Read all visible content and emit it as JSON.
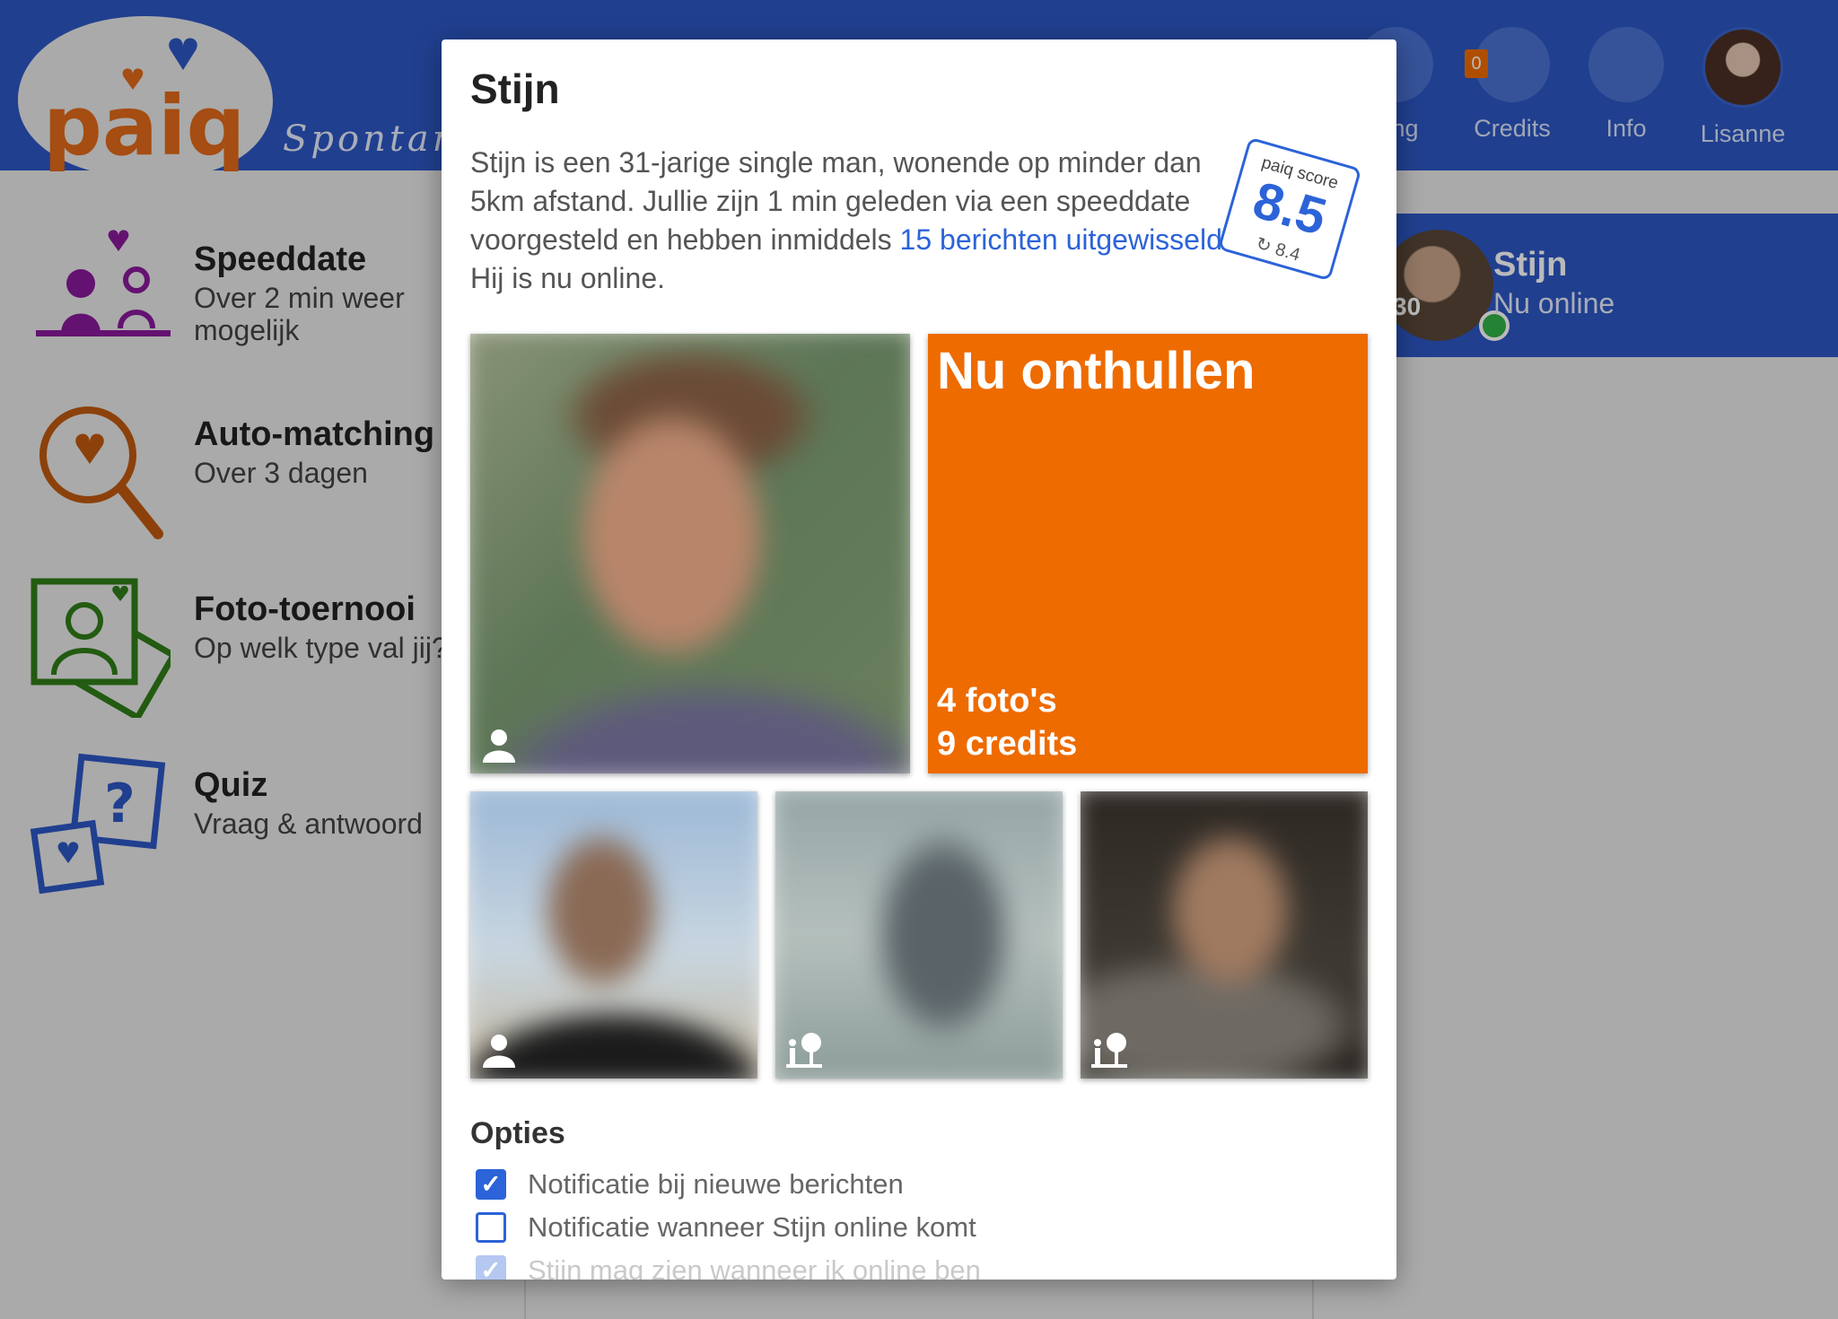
{
  "header": {
    "logo_text": "paiq",
    "tagline": "Spontan",
    "nav": [
      {
        "label": "ning",
        "icon": "gear-icon"
      },
      {
        "label": "Credits",
        "icon": "coins-icon",
        "badge": "0"
      },
      {
        "label": "Info",
        "icon": "info-icon"
      },
      {
        "label": "Lisanne",
        "icon": "avatar"
      }
    ]
  },
  "sidebar": {
    "items": [
      {
        "title": "Speeddate",
        "subtitle": "Over 2 min weer mogelijk",
        "icon": "speeddate-icon",
        "color": "#8a1a9b"
      },
      {
        "title": "Auto-matching",
        "subtitle": "Over 3 dagen",
        "icon": "magnifier-heart-icon",
        "color": "#c05a10"
      },
      {
        "title": "Foto-toernooi",
        "subtitle": "Op welk type val jij?",
        "icon": "photo-tournament-icon",
        "color": "#2f7d18"
      },
      {
        "title": "Quiz",
        "subtitle": "Vraag & antwoord",
        "icon": "quiz-icon",
        "color": "#2c57c4"
      }
    ]
  },
  "chat": {
    "name": "Stijn",
    "status": "Nu online",
    "age": "30"
  },
  "modal": {
    "title": "Stijn",
    "desc_pre": "Stijn is een 31-jarige single man, wonende op minder dan 5km afstand. Jullie zijn 1 min geleden via een speeddate voorgesteld en hebben inmiddels ",
    "desc_link": "15 berichten uitgewisseld",
    "desc_post": ". Hij is nu online.",
    "score": {
      "label": "paiq score",
      "value": "8.5",
      "previous": "8.4"
    },
    "reveal": {
      "title": "Nu onthullen",
      "photos": "4 foto's",
      "credits": "9 credits",
      "color": "#ee6b00"
    },
    "options_title": "Opties",
    "options": [
      {
        "label": "Notificatie bij nieuwe berichten",
        "checked": true
      },
      {
        "label": "Notificatie wanneer Stijn online komt",
        "checked": false
      },
      {
        "label": "Stijn mag zien wanneer ik online ben",
        "checked": true
      }
    ]
  },
  "colors": {
    "brand_blue": "#2c57c4",
    "link_blue": "#2c63d8",
    "orange": "#ee6b00",
    "online_green": "#31b247"
  }
}
